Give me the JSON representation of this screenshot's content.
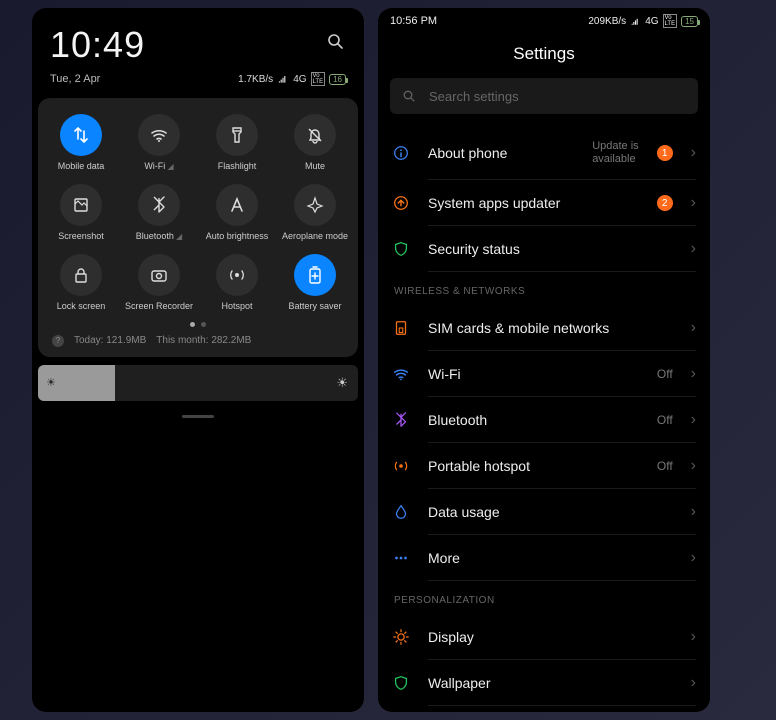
{
  "left": {
    "clock": "10:49",
    "date": "Tue, 2 Apr",
    "net_speed": "1.7KB/s",
    "net_type": "4G",
    "net_tag": "Vo\nLTE",
    "battery": "16",
    "tiles": [
      {
        "label": "Mobile data",
        "active": true,
        "icon": "arrows-updown"
      },
      {
        "label": "Wi-Fi",
        "sub": "◢",
        "active": false,
        "icon": "wifi"
      },
      {
        "label": "Flashlight",
        "active": false,
        "icon": "flashlight"
      },
      {
        "label": "Mute",
        "active": false,
        "icon": "bell-off"
      },
      {
        "label": "Screenshot",
        "active": false,
        "icon": "screenshot"
      },
      {
        "label": "Bluetooth",
        "sub": "◢",
        "active": false,
        "icon": "bluetooth"
      },
      {
        "label": "Auto brightness",
        "active": false,
        "icon": "letter-a"
      },
      {
        "label": "Aeroplane mode",
        "active": false,
        "icon": "plane"
      },
      {
        "label": "Lock screen",
        "active": false,
        "icon": "lock"
      },
      {
        "label": "Screen Recorder",
        "active": false,
        "icon": "camera"
      },
      {
        "label": "Hotspot",
        "active": false,
        "icon": "hotspot"
      },
      {
        "label": "Battery saver",
        "active": true,
        "icon": "battery-plus"
      }
    ],
    "usage_today_label": "Today:",
    "usage_today": "121.9MB",
    "usage_month_label": "This month:",
    "usage_month": "282.2MB"
  },
  "right": {
    "clock": "10:56 PM",
    "net_speed": "209KB/s",
    "net_type": "4G",
    "battery": "15",
    "title": "Settings",
    "search_placeholder": "Search settings",
    "rows_top": [
      {
        "label": "About phone",
        "meta": "Update is\navailable",
        "badge": "1",
        "icon": "info",
        "color": "#3b82f6"
      },
      {
        "label": "System apps updater",
        "badge": "2",
        "icon": "arrow-up",
        "color": "#f97316"
      },
      {
        "label": "Security status",
        "icon": "shield",
        "color": "#22c55e"
      }
    ],
    "section_wireless": "WIRELESS & NETWORKS",
    "rows_wireless": [
      {
        "label": "SIM cards & mobile networks",
        "icon": "sim",
        "color": "#f97316"
      },
      {
        "label": "Wi-Fi",
        "val": "Off",
        "icon": "wifi",
        "color": "#3b82f6"
      },
      {
        "label": "Bluetooth",
        "val": "Off",
        "icon": "bluetooth",
        "color": "#a855f7"
      },
      {
        "label": "Portable hotspot",
        "val": "Off",
        "icon": "hotspot",
        "color": "#f97316"
      },
      {
        "label": "Data usage",
        "icon": "drop",
        "color": "#3b82f6"
      },
      {
        "label": "More",
        "icon": "dots",
        "color": "#3b82f6"
      }
    ],
    "section_personal": "PERSONALIZATION",
    "rows_personal": [
      {
        "label": "Display",
        "icon": "sun",
        "color": "#f97316"
      },
      {
        "label": "Wallpaper",
        "icon": "shield",
        "color": "#22c55e"
      }
    ]
  }
}
